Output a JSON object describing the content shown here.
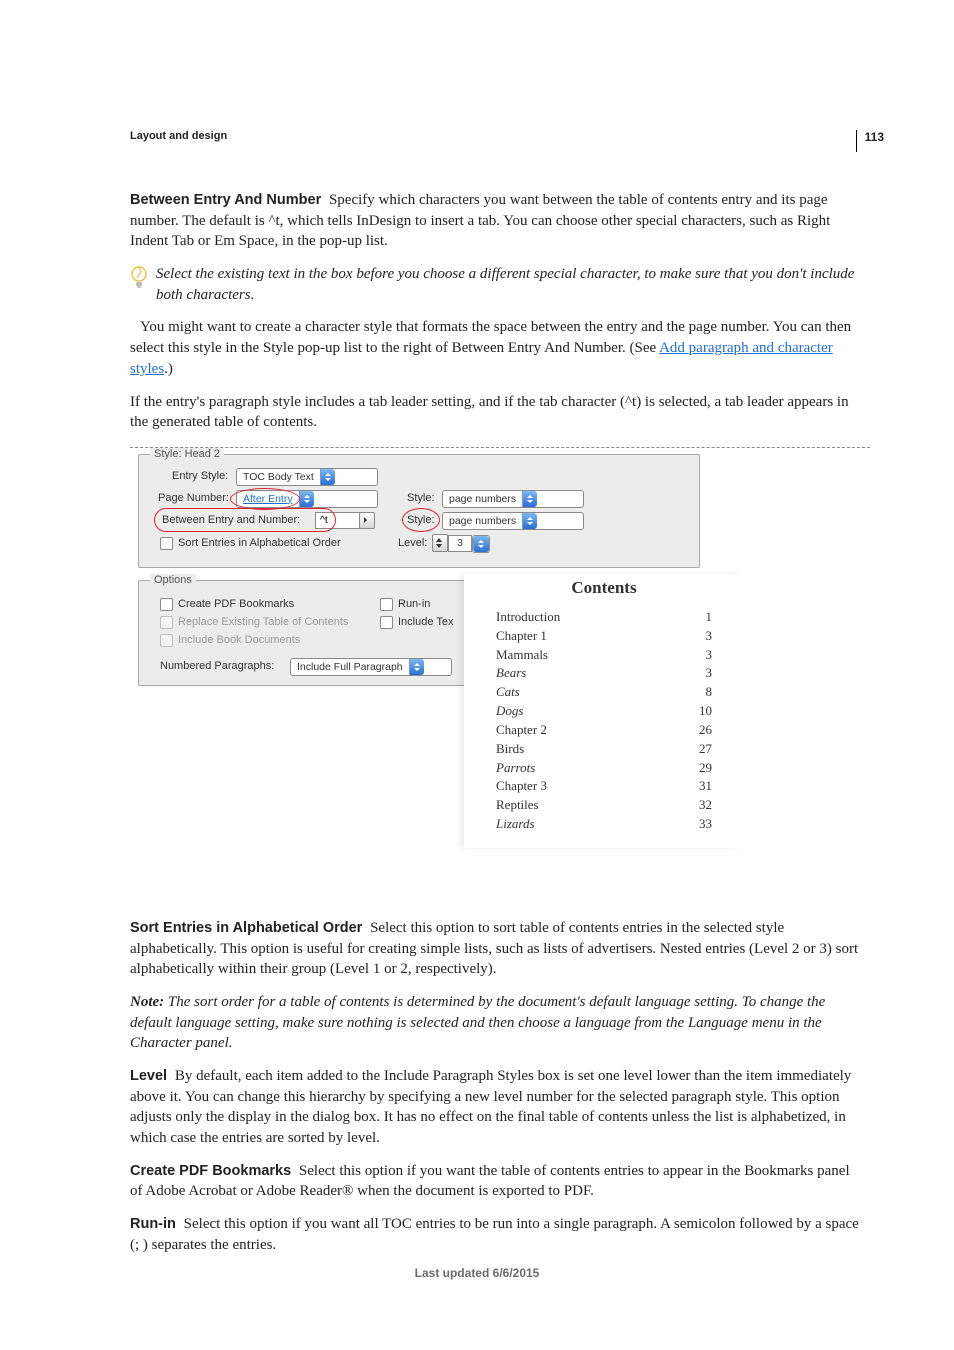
{
  "page_number": "113",
  "section_header": "Layout and design",
  "para_between": {
    "term": "Between Entry And Number",
    "text": "Specify which characters you want between the table of contents entry and its page number. The default is ^t, which tells InDesign to insert a tab. You can choose other special characters, such as Right Indent Tab or Em Space, in the pop-up list."
  },
  "tip_text": "Select the existing text in the box before you choose a different special character, to make sure that you don't include both characters.",
  "para_charstyle_a": "You might want to create a character style that formats the space between the entry and the page number. You can then select this style in the Style pop-up list to the right of Between Entry And Number. (See ",
  "link_text": "Add paragraph and character styles",
  "para_charstyle_b": ".)",
  "para_tab_leader": "If the entry's paragraph style includes a tab leader setting, and if the tab character (^t) is selected, a tab leader appears in the generated table of contents.",
  "figure": {
    "legend_style_head": "Style: Head 2",
    "entry_style_lbl": "Entry Style:",
    "entry_style_val": "TOC Body Text",
    "page_number_lbl": "Page Number:",
    "page_number_val": "After Entry",
    "style_lbl1": "Style:",
    "style_val1": "page numbers",
    "between_lbl": "Between Entry and Number:",
    "between_val": "^t",
    "style_lbl2": "Style:",
    "style_val2": "page numbers",
    "sort_lbl": "Sort Entries in Alphabetical Order",
    "level_lbl": "Level:",
    "level_val": "3",
    "options_legend": "Options",
    "opt_pdf": "Create PDF Bookmarks",
    "opt_replace": "Replace Existing Table of Contents",
    "opt_include_book": "Include Book Documents",
    "opt_runin": "Run-in",
    "opt_include_text": "Include Tex",
    "num_para_lbl": "Numbered Paragraphs:",
    "num_para_val": "Include Full Paragraph",
    "toc_title": "Contents",
    "toc_rows": [
      {
        "t": "Introduction",
        "p": "1",
        "ital": false
      },
      {
        "t": "Chapter 1",
        "p": "3",
        "ital": false
      },
      {
        "t": "Mammals",
        "p": "3",
        "ital": false
      },
      {
        "t": "Bears",
        "p": "3",
        "ital": true
      },
      {
        "t": "Cats",
        "p": "8",
        "ital": true
      },
      {
        "t": "Dogs",
        "p": "10",
        "ital": true
      },
      {
        "t": "Chapter 2",
        "p": "26",
        "ital": false
      },
      {
        "t": "Birds",
        "p": "27",
        "ital": false
      },
      {
        "t": "Parrots",
        "p": "29",
        "ital": true
      },
      {
        "t": "Chapter 3",
        "p": "31",
        "ital": false
      },
      {
        "t": "Reptiles",
        "p": "32",
        "ital": false
      },
      {
        "t": "Lizards",
        "p": "33",
        "ital": true
      }
    ]
  },
  "para_sort": {
    "term": "Sort Entries in Alphabetical Order",
    "text": "Select this option to sort table of contents entries in the selected style alphabetically. This option is useful for creating simple lists, such as lists of advertisers. Nested entries (Level 2 or 3) sort alphabetically within their group (Level 1 or 2, respectively)."
  },
  "note": {
    "label": "Note:",
    "text": "The sort order for a table of contents is determined by the document's default language setting. To change the default language setting, make sure nothing is selected and then choose a language from the Language menu in the Character panel."
  },
  "para_level": {
    "term": "Level",
    "text": "By default, each item added to the Include Paragraph Styles box is set one level lower than the item immediately above it. You can change this hierarchy by specifying a new level number for the selected paragraph style. This option adjusts only the display in the dialog box. It has no effect on the final table of contents unless the list is alphabetized, in which case the entries are sorted by level."
  },
  "para_pdf": {
    "term": "Create PDF Bookmarks",
    "text": "Select this option if you want the table of contents entries to appear in the Bookmarks panel of Adobe Acrobat or Adobe Reader® when the document is exported to PDF."
  },
  "para_runin": {
    "term": "Run-in",
    "text": "Select this option if you want all TOC entries to be run into a single paragraph. A semicolon followed by a space (; ) separates the entries."
  },
  "footer": "Last updated 6/6/2015"
}
